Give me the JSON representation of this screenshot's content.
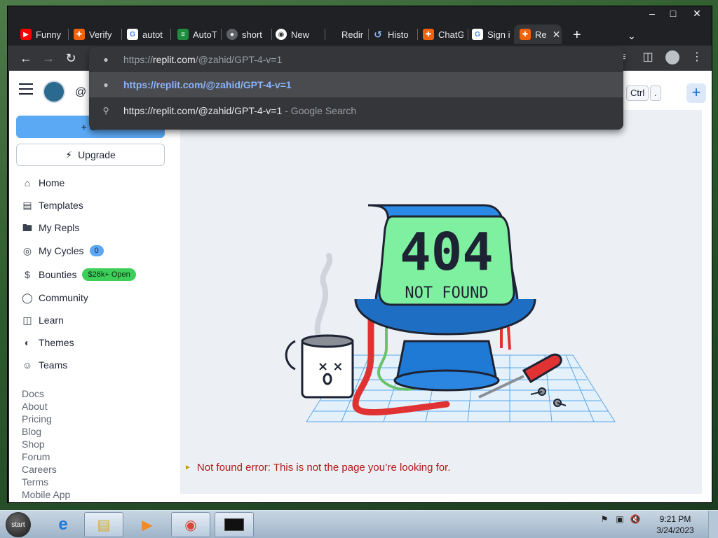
{
  "tabs": [
    {
      "label": "Funny",
      "icon": "youtube-icon",
      "color": "#ff0000"
    },
    {
      "label": "Verify",
      "icon": "replit-icon",
      "color": "#f26207"
    },
    {
      "label": "autot",
      "icon": "google-icon",
      "color": "#ffffff"
    },
    {
      "label": "AutoT",
      "icon": "sheets-icon",
      "color": "#1e8e3e"
    },
    {
      "label": "short",
      "icon": "globe-icon",
      "color": "#9aa0a6"
    },
    {
      "label": "New",
      "icon": "chrome-icon",
      "color": "#ffffff"
    },
    {
      "label": "Redir",
      "icon": "none",
      "color": "#35363a"
    },
    {
      "label": "Histo",
      "icon": "history-icon",
      "color": "#8ab4f8"
    },
    {
      "label": "ChatG",
      "icon": "replit-icon",
      "color": "#f26207"
    },
    {
      "label": "Sign i",
      "icon": "google-icon",
      "color": "#ffffff"
    },
    {
      "label": "Re",
      "icon": "replit-icon",
      "color": "#f26207"
    }
  ],
  "omnibox": {
    "input_prefix": "https://",
    "input_host": "replit.com",
    "input_path": "/@zahid/GPT-4-v=1",
    "suggestion_url": "https://replit.com/@zahid/GPT-4-v=1",
    "search_text": "https://replit.com/@zahid/GPT-4-v=1",
    "search_hint": "- Google Search"
  },
  "topbar": {
    "at": "@",
    "kbd_ctrl": "Ctrl",
    "kbd_dot": ".",
    "plus": "+"
  },
  "sidebar": {
    "create_label": "+ Cr",
    "upgrade_label": "Upgrade",
    "items": [
      {
        "label": "Home",
        "icon": "home-icon"
      },
      {
        "label": "Templates",
        "icon": "templates-icon"
      },
      {
        "label": "My Repls",
        "icon": "folder-icon"
      },
      {
        "label": "My Cycles",
        "icon": "cycles-icon",
        "badge": "0"
      },
      {
        "label": "Bounties",
        "icon": "dollar-icon",
        "badge": "$26k+ Open"
      },
      {
        "label": "Community",
        "icon": "globe-icon"
      },
      {
        "label": "Learn",
        "icon": "book-icon"
      },
      {
        "label": "Themes",
        "icon": "palette-icon"
      },
      {
        "label": "Teams",
        "icon": "people-icon"
      }
    ],
    "footer_links": [
      "Docs",
      "About",
      "Pricing",
      "Blog",
      "Shop",
      "Forum",
      "Careers",
      "Terms",
      "Mobile App"
    ]
  },
  "main": {
    "display_number": "404",
    "display_text": "NOT FOUND",
    "error_message": "Not found error: This is not the page you’re looking for."
  },
  "taskbar": {
    "start_label": "start",
    "time": "9:21 PM",
    "date": "3/24/2023"
  },
  "colors": {
    "accent": "#5ba8f5",
    "bounty": "#3ecf5a",
    "error": "#b21b1b",
    "lcd": "#7ff0a0"
  }
}
